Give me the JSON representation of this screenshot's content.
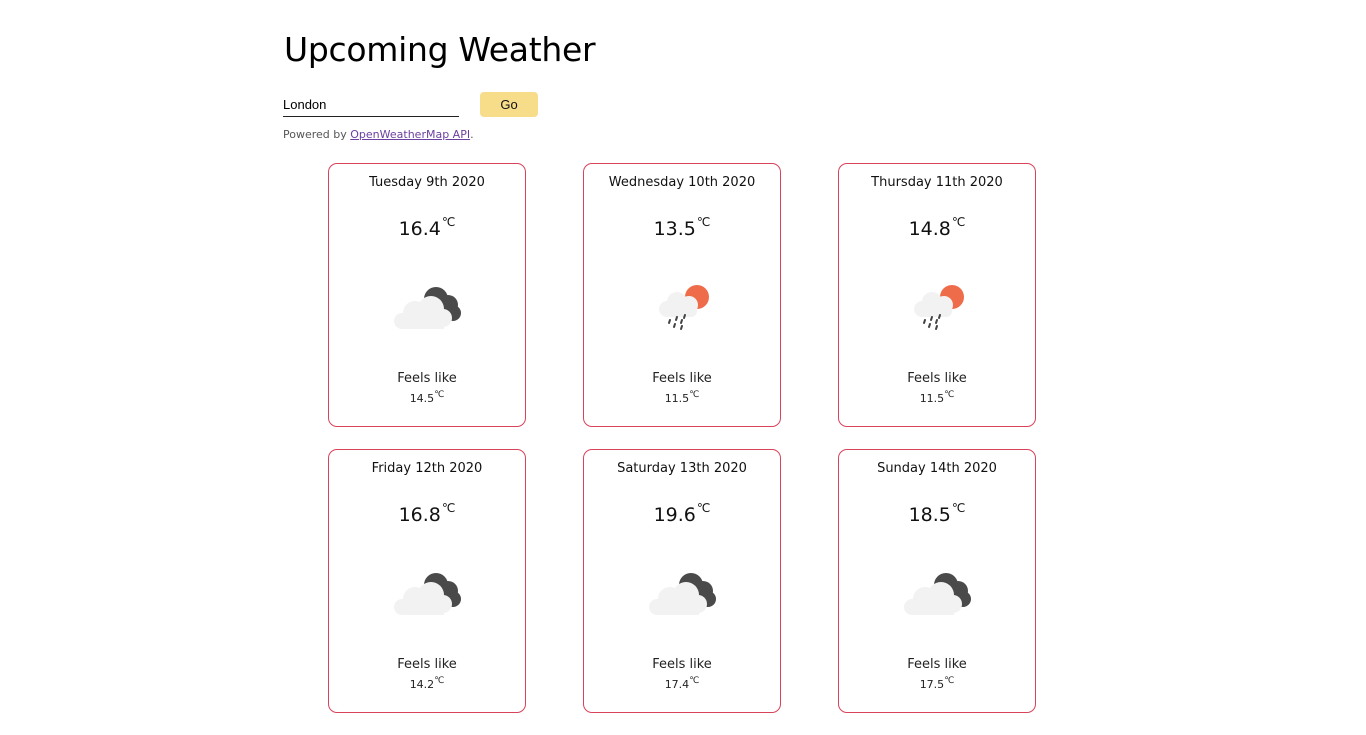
{
  "header": {
    "title": "Upcoming Weather"
  },
  "search": {
    "value": "London",
    "button_label": "Go"
  },
  "powered": {
    "prefix": "Powered by ",
    "link_text": "OpenWeatherMap API",
    "suffix": "."
  },
  "unit": "℃",
  "colors": {
    "card_border": "#d8435a",
    "button_bg": "#f7dc8a",
    "link": "#6b3fa0"
  },
  "forecast": [
    {
      "date": "Tuesday 9th 2020",
      "temp": "16.4",
      "feels_label": "Feels like",
      "feels": "14.5",
      "icon": "cloudy-icon"
    },
    {
      "date": "Wednesday 10th 2020",
      "temp": "13.5",
      "feels_label": "Feels like",
      "feels": "11.5",
      "icon": "rain-sun-icon"
    },
    {
      "date": "Thursday 11th 2020",
      "temp": "14.8",
      "feels_label": "Feels like",
      "feels": "11.5",
      "icon": "rain-sun-icon"
    },
    {
      "date": "Friday 12th 2020",
      "temp": "16.8",
      "feels_label": "Feels like",
      "feels": "14.2",
      "icon": "cloudy-icon"
    },
    {
      "date": "Saturday 13th 2020",
      "temp": "19.6",
      "feels_label": "Feels like",
      "feels": "17.4",
      "icon": "cloudy-icon"
    },
    {
      "date": "Sunday 14th 2020",
      "temp": "18.5",
      "feels_label": "Feels like",
      "feels": "17.5",
      "icon": "cloudy-icon"
    }
  ]
}
